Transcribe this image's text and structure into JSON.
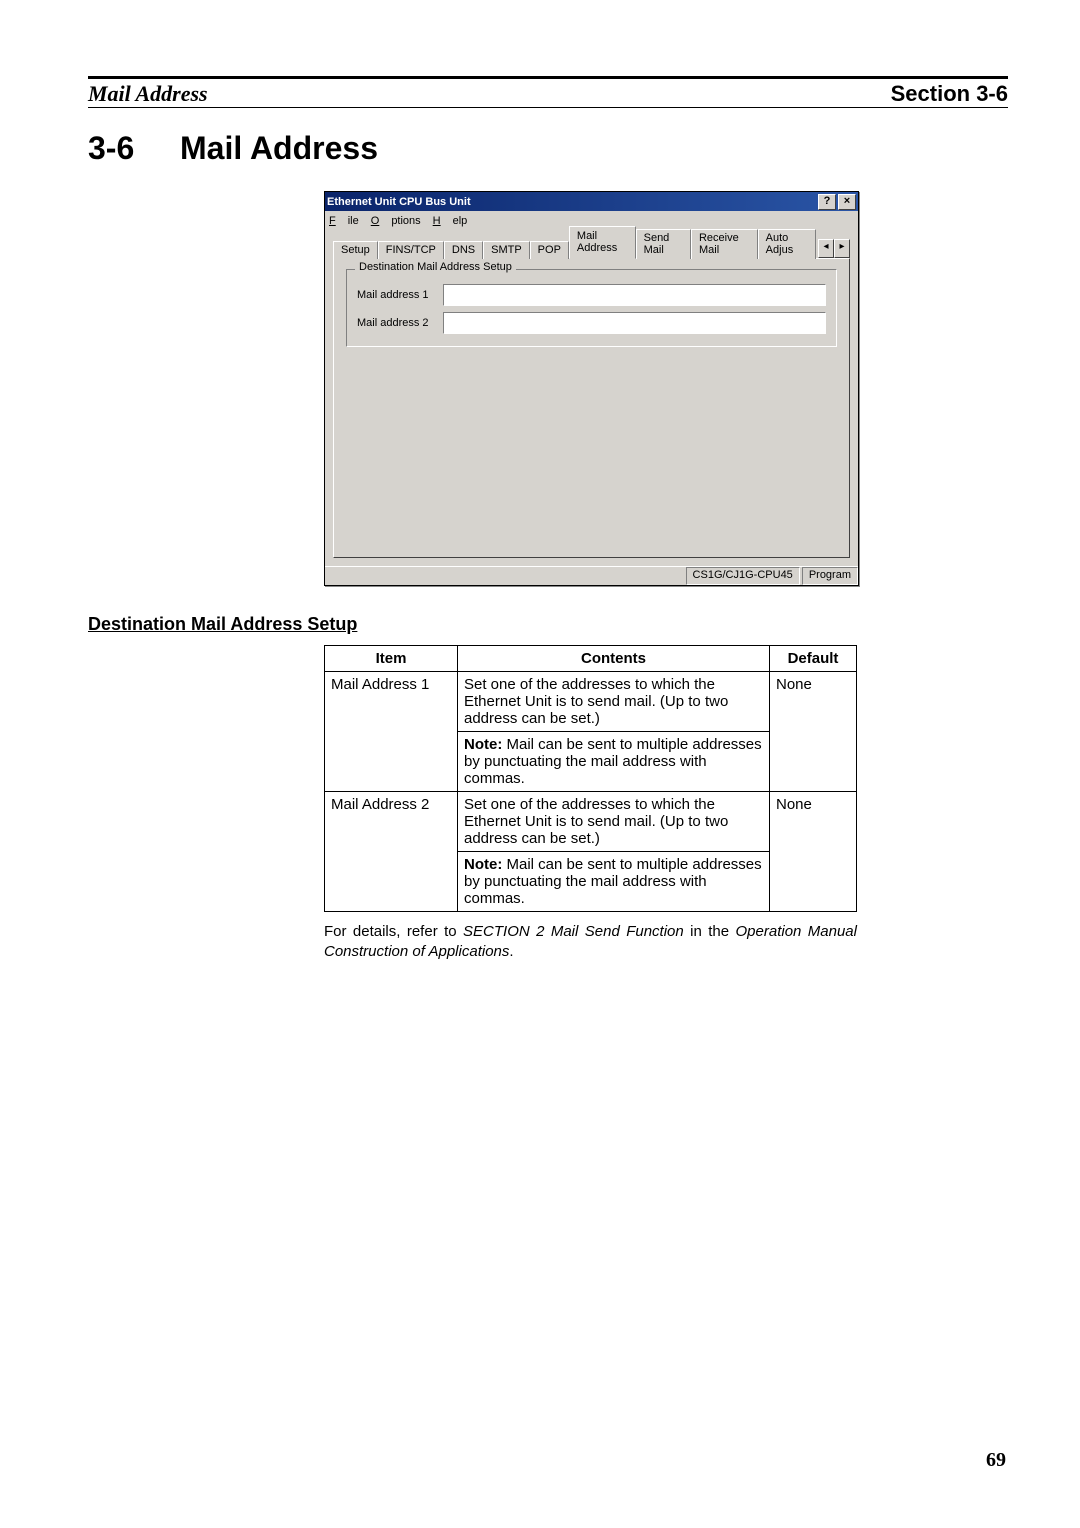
{
  "header": {
    "left": "Mail Address",
    "right": "Section 3-6"
  },
  "heading": {
    "num": "3-6",
    "title": "Mail Address"
  },
  "win": {
    "title": "Ethernet Unit CPU Bus Unit",
    "help": "?",
    "close": "×",
    "menu": {
      "file": "File",
      "options": "Options",
      "help": "Help"
    },
    "tabs": {
      "setup": "Setup",
      "finstcp": "FINS/TCP",
      "dns": "DNS",
      "smtp": "SMTP",
      "pop": "POP",
      "mailaddr": "Mail Address",
      "sendmail": "Send Mail",
      "recvmail": "Receive Mail",
      "autoadj": "Auto Adjus",
      "left": "◂",
      "right": "▸"
    },
    "group": {
      "legend": "Destination Mail Address Setup",
      "row1": "Mail address 1",
      "val1": "",
      "row2": "Mail address 2",
      "val2": ""
    },
    "status": {
      "cpu": "CS1G/CJ1G-CPU45",
      "mode": "Program"
    }
  },
  "subhead": "Destination Mail Address Setup",
  "table": {
    "h_item": "Item",
    "h_contents": "Contents",
    "h_default": "Default",
    "r1_item": "Mail Address 1",
    "r1_c1": "Set one of the addresses to which the Ethernet Unit is to send mail. (Up to two address can be set.)",
    "r1_note_b": "Note:",
    "r1_note": " Mail can be sent to multiple addresses by punctuating the mail address with commas.",
    "r1_def": "None",
    "r2_item": "Mail Address 2",
    "r2_c1": "Set one of the addresses to which the Ethernet Unit is to send mail. (Up to two address can be set.)",
    "r2_note_b": "Note:",
    "r2_note": " Mail can be sent to multiple addresses by punctuating the mail address with commas.",
    "r2_def": "None"
  },
  "after": {
    "pre": "For details, refer to ",
    "it1": "SECTION 2 Mail Send Function",
    "mid": " in the ",
    "it2": "Operation Manual Construction of Applications",
    "post": "."
  },
  "pagenum": "69"
}
